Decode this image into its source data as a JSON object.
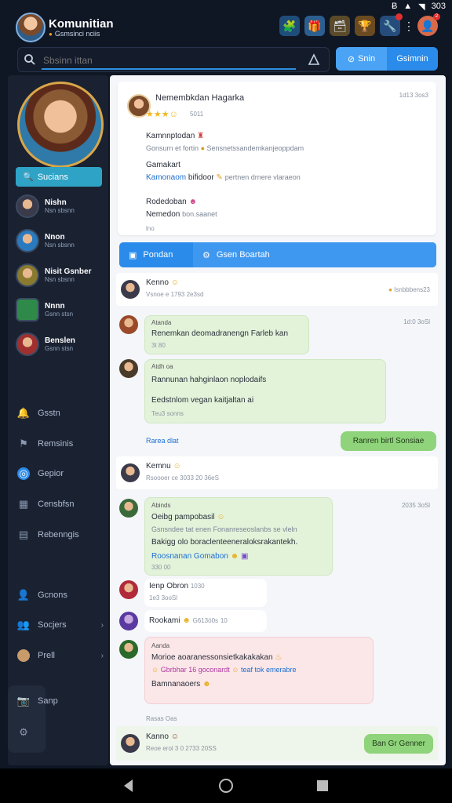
{
  "status_bar": {
    "battery": "303"
  },
  "header": {
    "title": "Komunitian",
    "subtitle": "Gsmsinci nciis",
    "icons": [
      "puzzle-icon",
      "gift-icon",
      "chest-icon",
      "trophy-icon",
      "wrench-icon",
      "more-icon",
      "profile-icon"
    ]
  },
  "search": {
    "placeholder": "Sbsinn ittan",
    "value": ""
  },
  "segmented": {
    "left": "Snin",
    "right": "Gsimnin"
  },
  "sidebar": {
    "search_label": "Sucians",
    "contacts": [
      {
        "name": "Nishn",
        "sub": "Nsn sbsnn"
      },
      {
        "name": "Nnon",
        "sub": "Nsn sbsnn"
      },
      {
        "name": "Nisit Gsnber",
        "sub": "Nsn sbsnn"
      },
      {
        "name": "Nnnn",
        "sub": "Gsnn stsn"
      },
      {
        "name": "Benslen",
        "sub": "Gsnn stsn"
      }
    ],
    "nav": [
      {
        "label": "Gsstn",
        "icon": "bell-icon"
      },
      {
        "label": "Remsinis",
        "icon": "flag-icon"
      },
      {
        "label": "Gepior",
        "icon": "compass-icon"
      },
      {
        "label": "Censbfsn",
        "icon": "calendar-icon"
      },
      {
        "label": "Rebenngis",
        "icon": "chart-icon"
      },
      {
        "label": "Gcnons",
        "icon": "user-icon"
      },
      {
        "label": "Socjers",
        "icon": "group-icon",
        "chevron": true
      },
      {
        "label": "Prell",
        "icon": "avatar-icon",
        "chevron": true
      },
      {
        "label": "Sanp",
        "icon": "camera-icon"
      }
    ]
  },
  "post": {
    "title": "Nemembkdan Hagarka",
    "time": "1d13 3os3",
    "rating": "5011",
    "h1": "Kamnnptodan",
    "t1": "Gonsurn et fortin",
    "t1b": "Sensnetssandemkanjeoppdam",
    "h2": "Gamakart",
    "t2": "Kamonaom",
    "t2b": "bifidoor",
    "t2c": "pertnen drnere vlaraeon",
    "h3": "Rodedoban",
    "t3": "Nemedon",
    "t3b": "bon.saanet",
    "t4": "lno"
  },
  "tabs": {
    "left": "Pondan",
    "right": "Gsen Boartah"
  },
  "chat": {
    "header1": {
      "name": "Kenno",
      "meta": "Vsnoe e 1793 2e3sd",
      "right": "Isnbbbens23"
    },
    "m1": {
      "author": "Atanda",
      "time": "1d:0 3oSl",
      "text": "Renemkan deomadranengn Farleb kan",
      "meta": "3t 80"
    },
    "m2": {
      "author": "Atdh oa",
      "line1": "Rannunan hahginlaon noplodaifs",
      "line2": "Eedstnlom vegan kaitjaltan ai",
      "meta": "Teu3 sonns"
    },
    "link1": "Rarea dlat",
    "btn1": "Ranren birtl Sonsiae",
    "header2": {
      "name": "Kemnu",
      "meta": "Rsoooer ce 3033 20 36eS"
    },
    "m3": {
      "author": "Abinds",
      "time": "2035 3oSl",
      "line1": "Oeibg pampobasil",
      "line2": "Gsnsndee tat enen Fonanreseoslanbs se vleln",
      "line3": "Bakigg olo boraclenteeneraloksrakantekh.",
      "line4": "Roosnanan Gomabon",
      "meta": "330 00"
    },
    "m4": {
      "name": "Ienp Obron",
      "time": "1030",
      "meta": "1e3 3ooSl"
    },
    "m5": {
      "name": "Rookami",
      "meta": "G613ö0s",
      "time": "10"
    },
    "m6": {
      "author": "Aanda",
      "line1": "Morioe aoaranessonsietkakakakan",
      "line2": "Gbrbhar 16 goconardt",
      "line3": "teaf tok emerabre",
      "line4": "Bamnanaoers"
    },
    "link2": "Rasas Oas",
    "footer": {
      "name": "Kanno",
      "meta": "Reoe erol 3 0 2733 20SS",
      "button": "Ban Gr Genner"
    }
  }
}
